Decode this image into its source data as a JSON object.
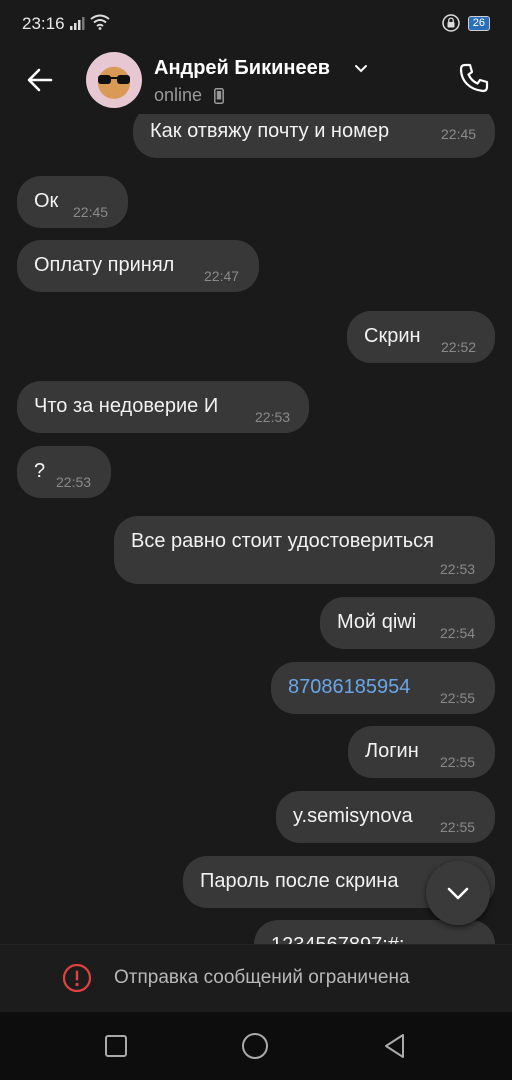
{
  "status_bar": {
    "time": "23:16",
    "battery": "26",
    "icons": [
      "signal-icon",
      "wifi-icon",
      "lock-icon",
      "battery-icon"
    ]
  },
  "header": {
    "contact_name": "Андрей Бикинеев",
    "presence": "online",
    "icons": [
      "back-arrow-icon",
      "chevron-down-icon",
      "phone-device-icon",
      "call-icon"
    ]
  },
  "messages": [
    {
      "text": "Как отвяжу почту и номер",
      "time": "22:45",
      "direction": "out"
    },
    {
      "text": "Ок",
      "time": "22:45",
      "direction": "in"
    },
    {
      "text": "Оплату принял",
      "time": "22:47",
      "direction": "in"
    },
    {
      "text": "Скрин",
      "time": "22:52",
      "direction": "out"
    },
    {
      "text": "Что за недоверие И",
      "time": "22:53",
      "direction": "in"
    },
    {
      "text": "?",
      "time": "22:53",
      "direction": "in"
    },
    {
      "text": "Все равно стоит удостовериться",
      "time": "22:53",
      "direction": "out"
    },
    {
      "text": "Мой qiwi",
      "time": "22:54",
      "direction": "out"
    },
    {
      "text": "87086185954",
      "time": "22:55",
      "direction": "out",
      "link": true
    },
    {
      "text": "Логин",
      "time": "22:55",
      "direction": "out"
    },
    {
      "text": "y.semisynova",
      "time": "22:55",
      "direction": "out"
    },
    {
      "text": "Пароль после скрина",
      "time": "",
      "direction": "out"
    },
    {
      "text": "1234567897;#;",
      "time": "",
      "direction": "out"
    }
  ],
  "restriction": {
    "text": "Отправка сообщений ограничена"
  },
  "colors": {
    "background": "#1a1a1b",
    "bubble": "#383839",
    "link": "#6aa6e6",
    "warning": "#e0423f"
  }
}
